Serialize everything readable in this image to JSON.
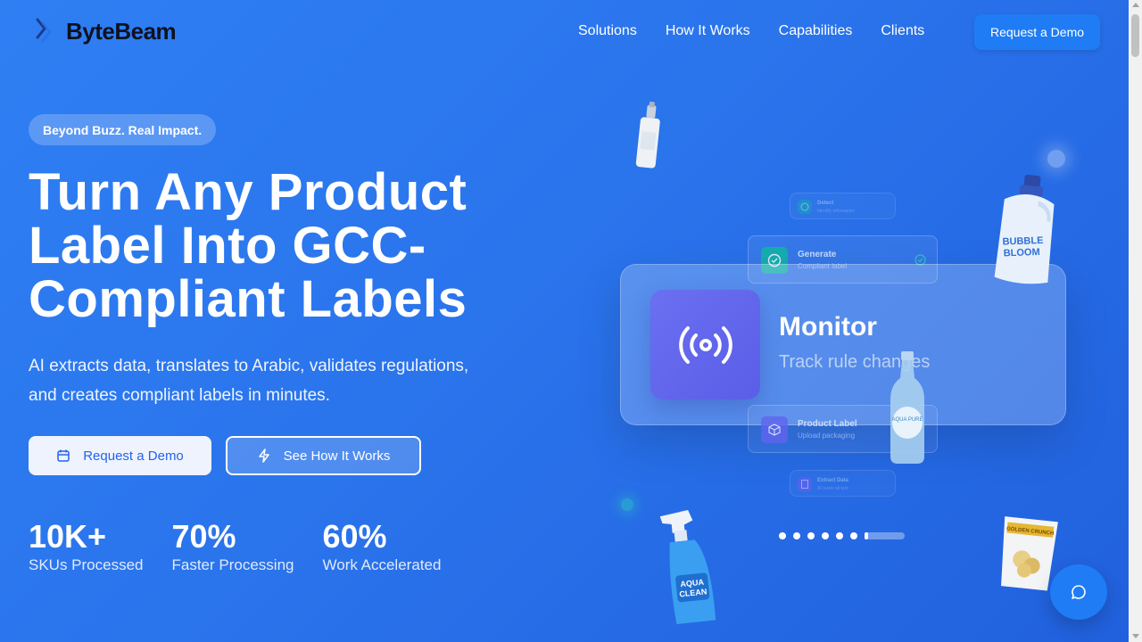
{
  "brand": {
    "name": "ByteBeam"
  },
  "nav": {
    "items": [
      "Solutions",
      "How It Works",
      "Capabilities",
      "Clients"
    ],
    "cta": "Request a Demo"
  },
  "hero": {
    "badge": "Beyond Buzz. Real Impact.",
    "headline_lines": [
      "Turn Any Product",
      "Label Into GCC-",
      "Compliant Labels"
    ],
    "subhead_lines": [
      "AI extracts data, translates to Arabic, validates regulations,",
      "and creates compliant labels in minutes."
    ],
    "primary_button": {
      "label": "Request a Demo",
      "icon": "calendar-icon"
    },
    "secondary_button": {
      "label": "See How It Works",
      "icon": "lightning-icon"
    },
    "stats": [
      {
        "value": "10K+",
        "label": "SKUs Processed"
      },
      {
        "value": "70%",
        "label": "Faster Processing"
      },
      {
        "value": "60%",
        "label": "Work Accelerated"
      }
    ]
  },
  "workflow": {
    "active": {
      "title": "Monitor",
      "subtitle": "Track rule changes",
      "icon": "broadcast-icon"
    },
    "steps": [
      {
        "title": "Detect",
        "subtitle": "Identify information",
        "icon": "globe-icon",
        "color": "#14b8a6"
      },
      {
        "title": "Generate",
        "subtitle": "Compliant label",
        "icon": "check-circle-icon",
        "color": "#14b8a6"
      },
      {
        "title": "Product Label",
        "subtitle": "Upload packaging",
        "icon": "box-icon",
        "color": "#6366f1"
      },
      {
        "title": "Extract Data",
        "subtitle": "AI reads all text",
        "icon": "document-icon",
        "color": "#8b5cf6"
      }
    ],
    "carousel": {
      "dots": 7,
      "active_index": 6
    }
  },
  "products": {
    "detergent": "BUBBLE BLOOM",
    "spray": "AQUA CLEAN",
    "chips": "GOLDEN CRUNCH",
    "water": "AQUA PURE"
  },
  "colors": {
    "accent": "#1f7cf5",
    "monitor_icon_bg": "#5a5ee8"
  },
  "chat": {
    "icon": "chat-bubble-icon"
  }
}
